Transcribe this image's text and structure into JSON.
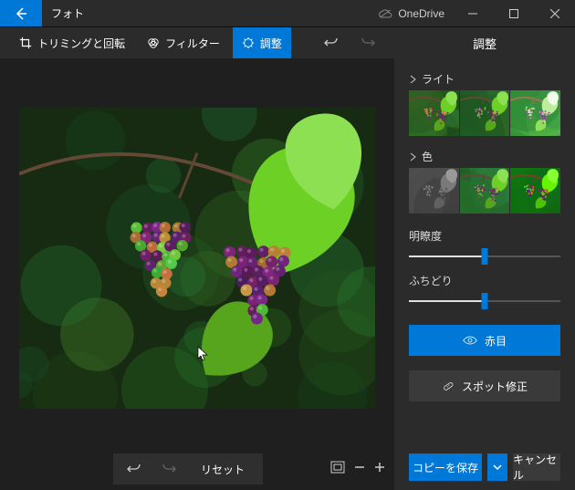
{
  "titlebar": {
    "app_name": "フォト",
    "onedrive": "OneDrive"
  },
  "toolbar": {
    "crop": "トリミングと回転",
    "filter": "フィルター",
    "adjust": "調整",
    "panel_title": "調整"
  },
  "panel": {
    "light": "ライト",
    "color": "色",
    "clarity": "明瞭度",
    "vignette": "ふちどり",
    "redeye": "赤目",
    "spotfix": "スポット修正"
  },
  "sliders": {
    "clarity_pct": 50,
    "vignette_pct": 50
  },
  "footer": {
    "reset": "リセット",
    "save": "コピーを保存",
    "cancel": "キャンセル"
  }
}
